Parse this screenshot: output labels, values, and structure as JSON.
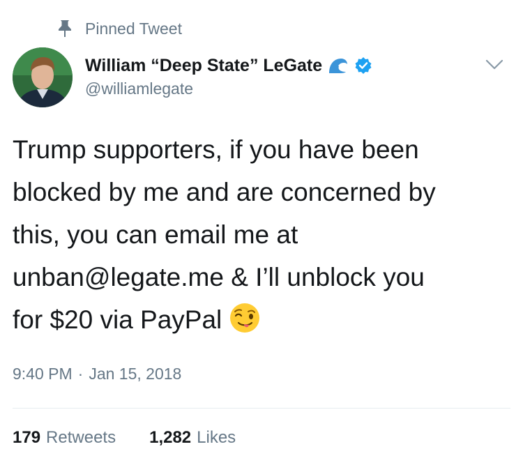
{
  "pinned": {
    "label": "Pinned Tweet",
    "icon": "pin-icon"
  },
  "author": {
    "display_name": "William “Deep State” LeGate",
    "handle": "@williamlegate",
    "badges": [
      "wave-icon",
      "verified-icon"
    ]
  },
  "tweet": {
    "lines": [
      "Trump supporters, if you have been",
      "blocked by me and are concerned by",
      "this, you can email me at",
      "unban@legate.me & I’ll unblock you",
      "for $20 via PayPal"
    ],
    "emoji": "winking-face-with-tongue-emoji"
  },
  "meta": {
    "time": "9:40 PM",
    "separator": "·",
    "date": "Jan 15, 2018"
  },
  "stats": {
    "retweets_count": "179",
    "retweets_label": "Retweets",
    "likes_count": "1,282",
    "likes_label": "Likes"
  },
  "colors": {
    "text": "#14171a",
    "secondary": "#657786",
    "verified": "#1da1f2",
    "divider": "#e6ecf0"
  }
}
